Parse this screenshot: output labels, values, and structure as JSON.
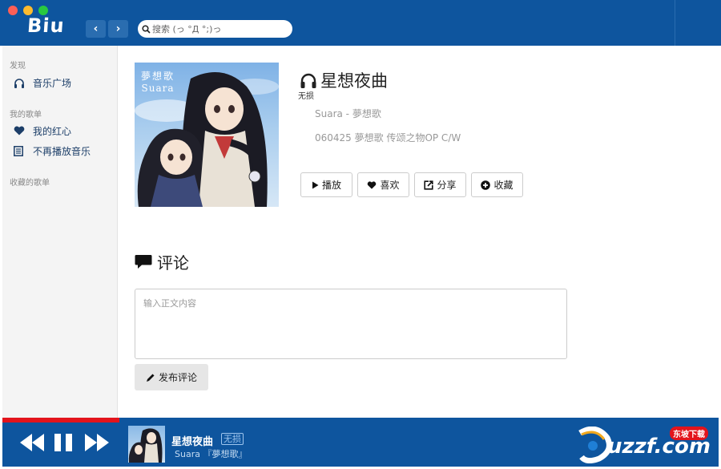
{
  "window": {
    "logo": "Biu",
    "search_placeholder": "搜索 (っ °Д °;)っ",
    "nav_back": "‹",
    "nav_forward": "›"
  },
  "sidebar": {
    "sections": [
      {
        "heading": "发现",
        "items": [
          {
            "label": "音乐广场",
            "icon": "headphones-icon"
          }
        ]
      },
      {
        "heading": "我的歌单",
        "items": [
          {
            "label": "我的红心",
            "icon": "heart-icon"
          },
          {
            "label": "不再播放音乐",
            "icon": "list-icon"
          }
        ]
      },
      {
        "heading": "收藏的歌单",
        "items": []
      }
    ]
  },
  "song": {
    "cover_title_1": "夢想歌",
    "cover_title_2": "Suara",
    "title": "星想夜曲",
    "quality_tag": "无损",
    "artist_line": "Suara - 夢想歌",
    "album_line": "060425 夢想歌 传颂之物OP C/W"
  },
  "actions": {
    "play": "播放",
    "like": "喜欢",
    "share": "分享",
    "collect": "收藏"
  },
  "comments": {
    "title": "评论",
    "placeholder": "输入正文内容",
    "submit": "发布评论"
  },
  "player": {
    "progress": 0.163,
    "now_title": "星想夜曲",
    "now_badge": "无损",
    "now_sub": "Suara 『夢想歌』"
  },
  "watermark": {
    "tag": "东坡下载",
    "text": "uzzf.com"
  },
  "colors": {
    "brand_blue": "#0e559e",
    "progress_red": "#e3141c",
    "sidebar_bg": "#f4f4f4"
  }
}
